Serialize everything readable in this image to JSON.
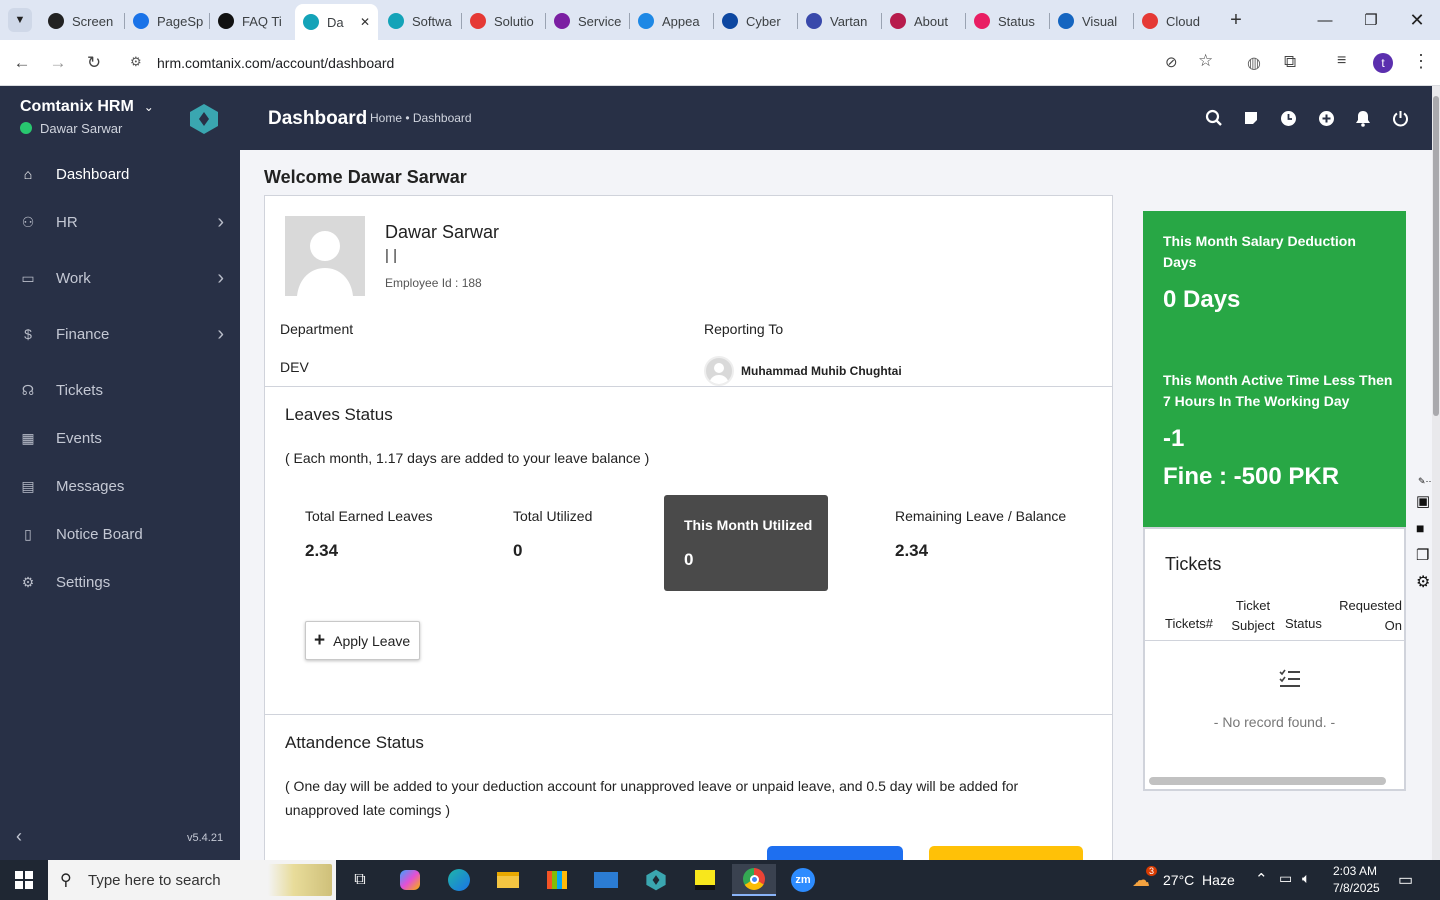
{
  "browser": {
    "tabs": [
      {
        "title": "Screen",
        "color": "#222222"
      },
      {
        "title": "PageSp",
        "color": "#1a73e8"
      },
      {
        "title": "FAQ Ti",
        "color": "#111111"
      },
      {
        "title": "Da",
        "color": "#14a3b8",
        "active": true
      },
      {
        "title": "Softwa",
        "color": "#14a3b8"
      },
      {
        "title": "Solutio",
        "color": "#e53935"
      },
      {
        "title": "Service",
        "color": "#7b1fa2"
      },
      {
        "title": "Appea",
        "color": "#1e88e5"
      },
      {
        "title": "Cyber",
        "color": "#0d47a1"
      },
      {
        "title": "Vartan",
        "color": "#3949ab"
      },
      {
        "title": "About",
        "color": "#b71c4c"
      },
      {
        "title": "Status",
        "color": "#e91e63"
      },
      {
        "title": "Visual",
        "color": "#1565c0"
      },
      {
        "title": "Cloud",
        "color": "#e53935"
      }
    ],
    "url": "hrm.comtanix.com/account/dashboard",
    "profile_initial": "t"
  },
  "sidebar": {
    "brand": "Comtanix HRM",
    "user": "Dawar Sarwar",
    "status_color": "#28c76f",
    "version": "v5.4.21",
    "items": [
      {
        "label": "Dashboard",
        "icon": "home-icon",
        "active": true
      },
      {
        "label": "HR",
        "icon": "users-icon",
        "chevron": true
      },
      {
        "label": "Work",
        "icon": "briefcase-icon",
        "chevron": true
      },
      {
        "label": "Finance",
        "icon": "dollar-icon",
        "chevron": true
      },
      {
        "label": "Tickets",
        "icon": "headset-icon"
      },
      {
        "label": "Events",
        "icon": "calendar-icon"
      },
      {
        "label": "Messages",
        "icon": "message-icon"
      },
      {
        "label": "Notice Board",
        "icon": "clipboard-icon"
      },
      {
        "label": "Settings",
        "icon": "gear-icon"
      }
    ]
  },
  "header": {
    "title": "Dashboard",
    "breadcrumb": "Home • Dashboard"
  },
  "main": {
    "welcome": "Welcome Dawar Sarwar",
    "profile": {
      "name": "Dawar Sarwar",
      "sep": "| |",
      "employee_id": "Employee Id : 188",
      "department_label": "Department",
      "department": "DEV",
      "reporting_label": "Reporting To",
      "reporting_to": "Muhammad Muhib Chughtai"
    },
    "leaves": {
      "title": "Leaves Status",
      "note": "( Each month, 1.17 days are added to your leave balance )",
      "earned_label": "Total Earned Leaves",
      "earned": "2.34",
      "utilized_label": "Total Utilized",
      "utilized": "0",
      "month_label": "This Month Utilized",
      "month": "0",
      "remaining_label": "Remaining Leave / Balance",
      "remaining": "2.34",
      "apply_label": "Apply Leave"
    },
    "attendance": {
      "title": "Attandence Status",
      "note": "( One day will be added to your deduction account for unapproved leave or unpaid leave, and 0.5 day will be added for unapproved late comings )"
    },
    "deduction": {
      "label1": "This Month Salary Deduction Days",
      "value1": "0 Days",
      "label2": "This Month Active Time Less Then 7 Hours In The Working Day",
      "value2": "-1",
      "fine": "Fine : -500 PKR",
      "color": "#28a745"
    },
    "tickets": {
      "title": "Tickets",
      "col1": "Tickets#",
      "col2": "Ticket Subject",
      "col3": "Status",
      "col4": "Requested On",
      "empty": "- No record found. -"
    }
  },
  "taskbar": {
    "search_placeholder": "Type here to search",
    "weather": "27°C  Haze",
    "weather_badge": "3",
    "time": "2:03 AM",
    "date": "7/8/2025"
  }
}
